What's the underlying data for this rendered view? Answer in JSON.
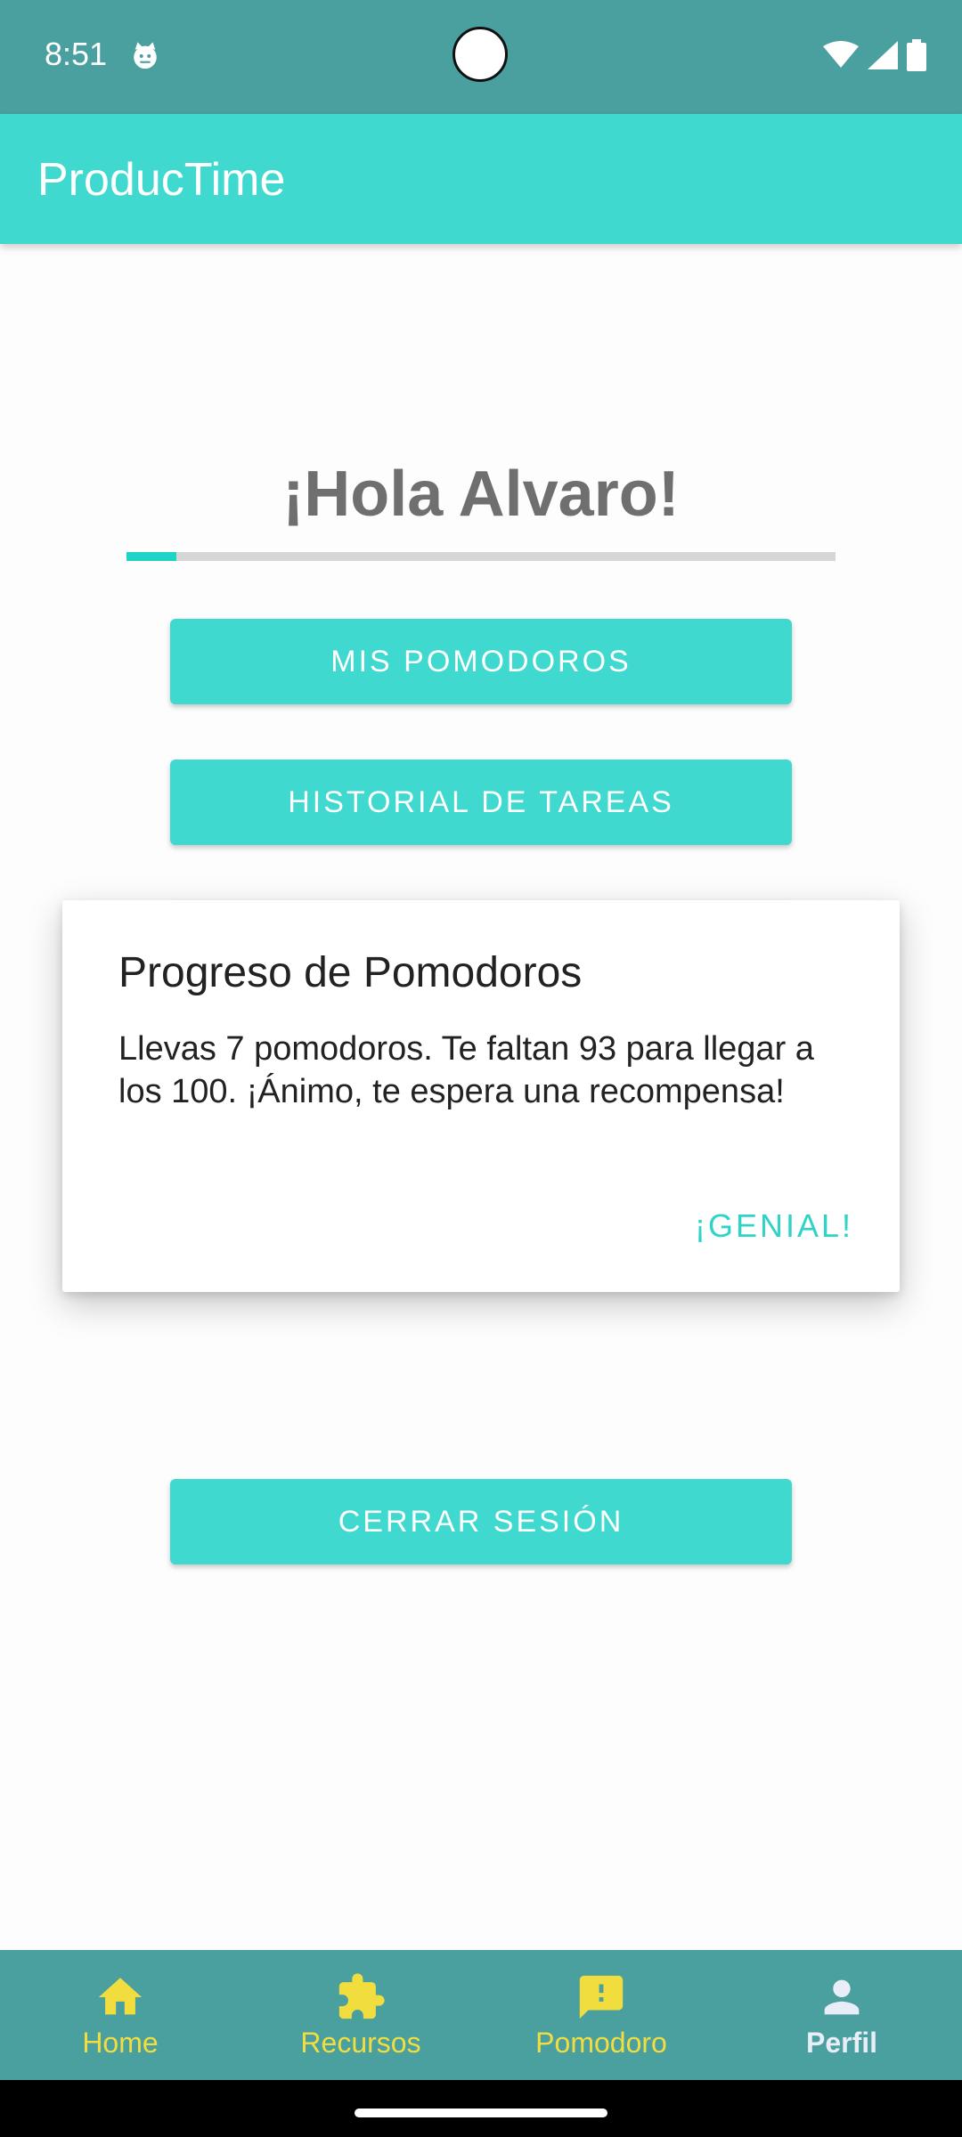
{
  "status_bar": {
    "time": "8:51"
  },
  "app_bar": {
    "title": "ProducTime"
  },
  "main": {
    "greeting": "¡Hola Alvaro!",
    "progress_fraction": 0.07,
    "buttons": {
      "pomodoros": "MIS POMODOROS",
      "historial": "HISTORIAL DE TAREAS",
      "cerrar": "CERRAR SESIÓN"
    }
  },
  "dialog": {
    "title": "Progreso de Pomodoros",
    "message": "Llevas 7 pomodoros. Te faltan 93 para llegar a los 100. ¡Ánimo, te espera una recompensa!",
    "action": "¡GENIAL!"
  },
  "bottom_nav": {
    "items": [
      {
        "label": "Home",
        "icon": "home-icon"
      },
      {
        "label": "Recursos",
        "icon": "puzzle-icon"
      },
      {
        "label": "Pomodoro",
        "icon": "feedback-icon"
      },
      {
        "label": "Perfil",
        "icon": "person-icon"
      }
    ],
    "active_index": 3
  },
  "colors": {
    "status_bar": "#4a9f9f",
    "app_bar": "#40d9cf",
    "accent": "#2fd3c8",
    "nav_inactive": "#f2dd3f",
    "nav_active": "#e9edf7"
  }
}
